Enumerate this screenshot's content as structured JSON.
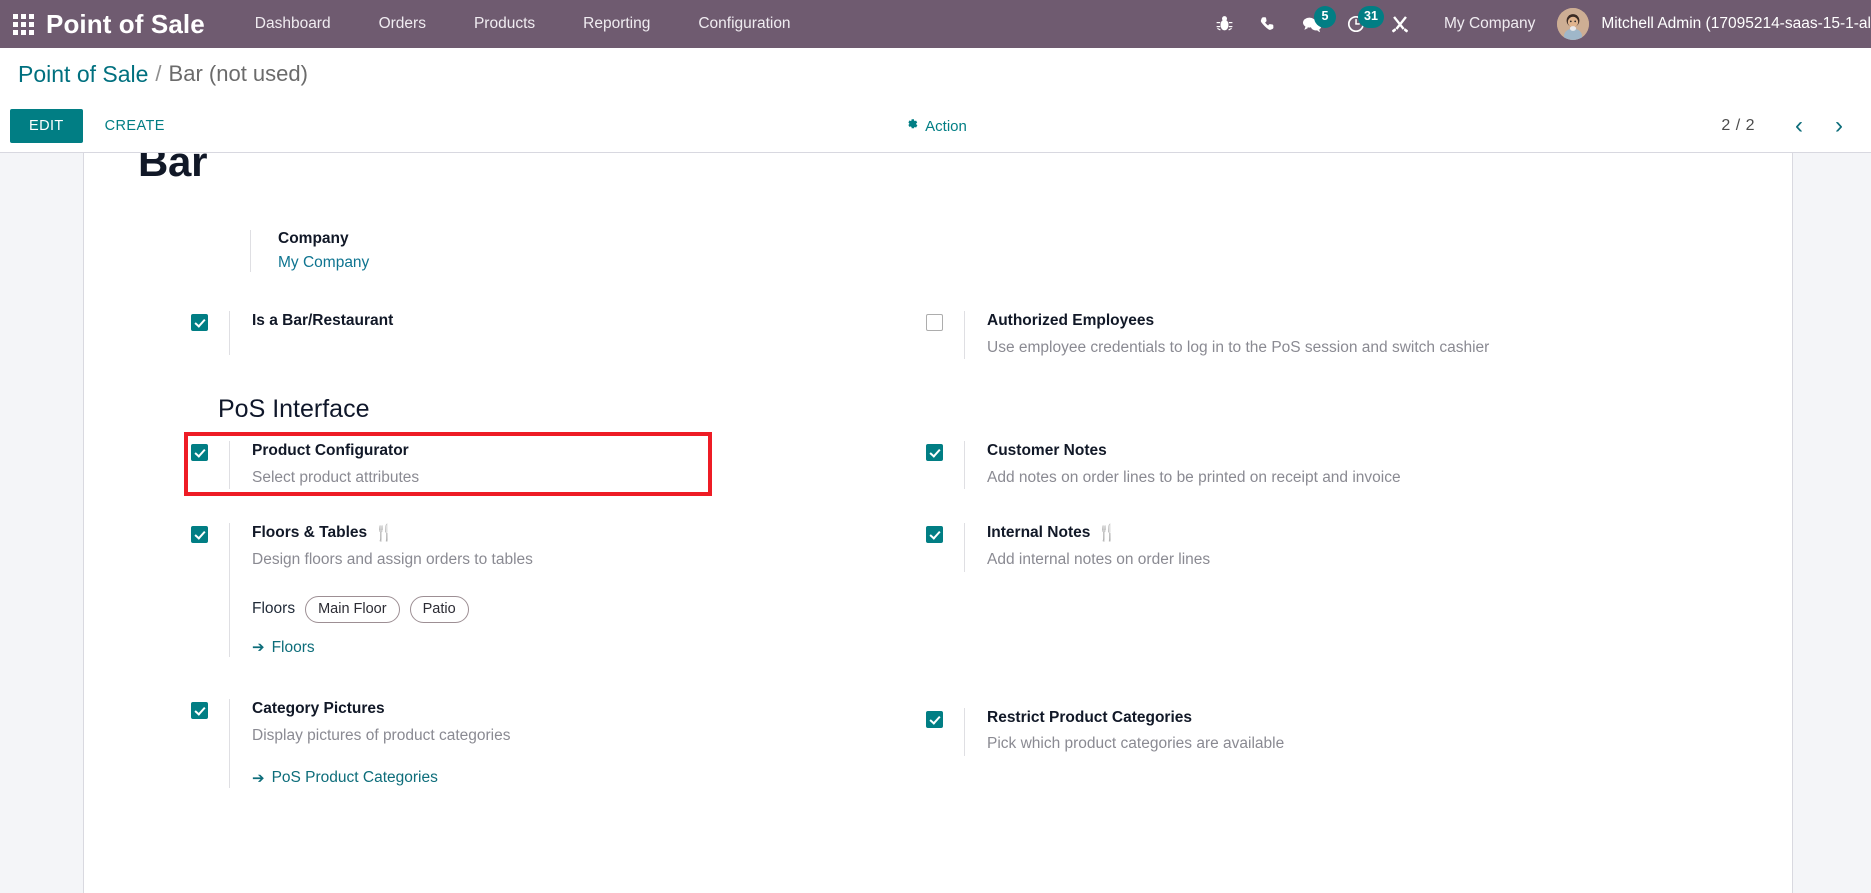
{
  "navbar": {
    "apps_icon": "apps-grid-icon",
    "brand": "Point of Sale",
    "menu": [
      {
        "label": "Dashboard"
      },
      {
        "label": "Orders"
      },
      {
        "label": "Products"
      },
      {
        "label": "Reporting"
      },
      {
        "label": "Configuration"
      }
    ],
    "icons": [
      {
        "name": "bug-icon",
        "badge": ""
      },
      {
        "name": "phone-icon",
        "badge": ""
      },
      {
        "name": "messages-icon",
        "badge": "5"
      },
      {
        "name": "activities-clock-icon",
        "badge": "31"
      },
      {
        "name": "tools-icon",
        "badge": ""
      }
    ],
    "company": "My Company",
    "user": "Mitchell Admin (17095214-saas-15-1-al",
    "background_color": "#6f5b70",
    "badge_color": "#017e84"
  },
  "breadcrumb": {
    "root": "Point of Sale",
    "separator": "/",
    "current": "Bar (not used)"
  },
  "control_panel": {
    "edit_label": "EDIT",
    "create_label": "CREATE",
    "action_label": "Action",
    "action_icon": "gear-icon",
    "pager_count": "2 / 2",
    "prev_icon": "‹",
    "next_icon": "›",
    "accent_color": "#017e84"
  },
  "record": {
    "title": "Bar"
  },
  "company_field": {
    "label": "Company",
    "value": "My Company"
  },
  "sections": [
    {
      "heading": "",
      "rows": [
        {
          "left": {
            "checked": true,
            "title": "Is a Bar/Restaurant",
            "help": "",
            "emoji": ""
          },
          "right": {
            "checked": false,
            "title": "Authorized Employees",
            "help": "Use employee credentials to log in to the PoS session and switch cashier",
            "emoji": ""
          }
        }
      ]
    }
  ],
  "pos_interface": {
    "heading": "PoS Interface",
    "rows": [
      {
        "left": {
          "checked": true,
          "title": "Product Configurator",
          "help": "Select product attributes",
          "emoji": "",
          "annotated": true
        },
        "right": {
          "checked": true,
          "title": "Customer Notes",
          "help": "Add notes on order lines to be printed on receipt and invoice",
          "emoji": ""
        }
      },
      {
        "left": {
          "checked": true,
          "title": "Floors & Tables",
          "help": "Design floors and assign orders to tables",
          "emoji": "🍴",
          "subfield_label": "Floors",
          "tags": [
            "Main Floor",
            "Patio"
          ],
          "link": "Floors"
        },
        "right": {
          "checked": true,
          "title": "Internal Notes",
          "help": "Add internal notes on order lines",
          "emoji": "🍴"
        }
      },
      {
        "left": {
          "checked": true,
          "title": "Category Pictures",
          "help": "Display pictures of product categories",
          "emoji": "",
          "link": "PoS Product Categories"
        },
        "right": {
          "checked": true,
          "title": "Restrict Product Categories",
          "help": "Pick which product categories are available",
          "emoji": ""
        }
      }
    ]
  }
}
